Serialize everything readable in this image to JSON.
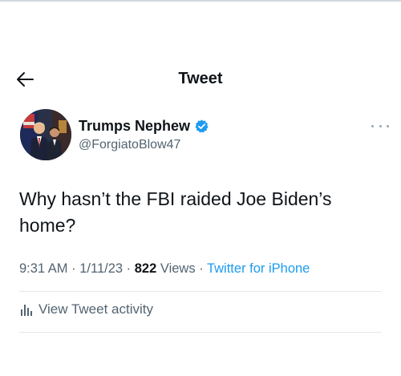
{
  "header": {
    "title": "Tweet",
    "back_icon": "arrow-left-icon"
  },
  "author": {
    "display_name": "Trumps Nephew",
    "handle": "@ForgiatoBlow47",
    "verified": true,
    "verified_color": "#1d9bf0",
    "more_icon": "more-horizontal-icon"
  },
  "tweet": {
    "text": "Why hasn’t the FBI raided Joe Biden’s home?",
    "time": "9:31 AM",
    "date": "1/11/23",
    "views_count": "822",
    "views_label": "Views",
    "source": "Twitter for iPhone",
    "separator": "·"
  },
  "activity": {
    "label": "View Tweet activity",
    "icon": "bar-chart-icon"
  },
  "colors": {
    "accent": "#1d9bf0",
    "text_primary": "#0f1419",
    "text_secondary": "#536471"
  }
}
